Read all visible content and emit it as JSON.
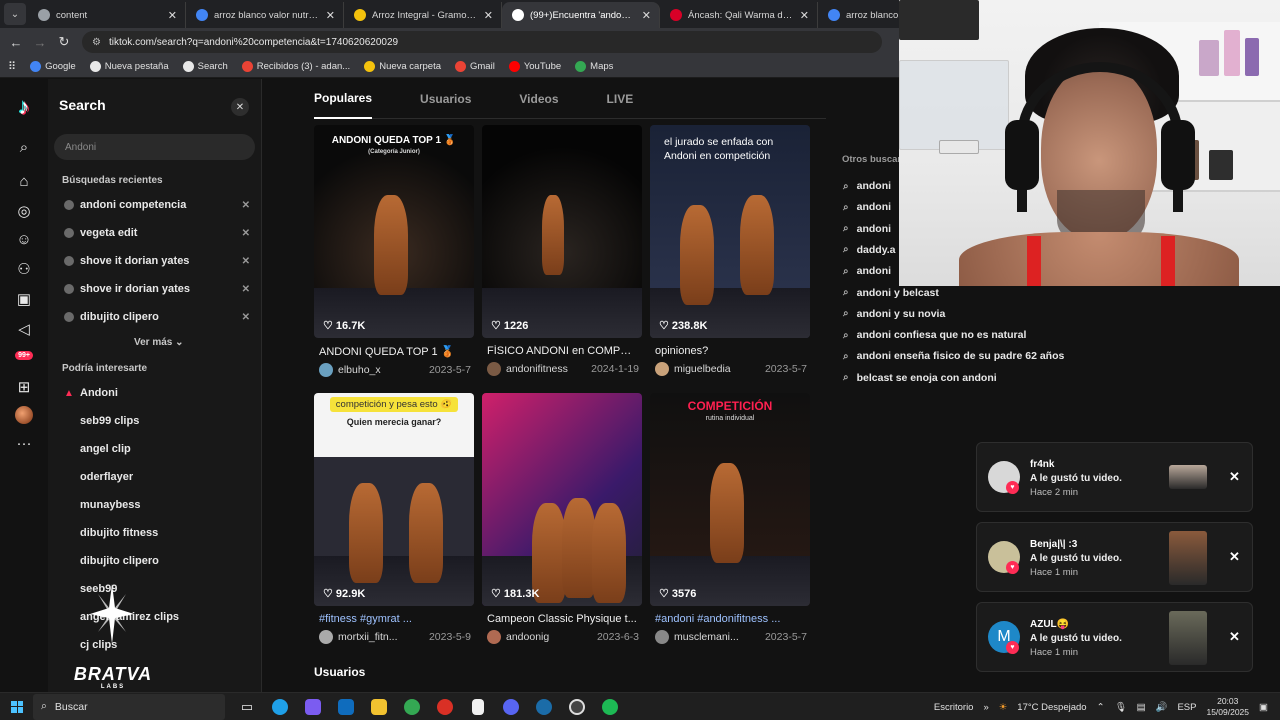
{
  "browser": {
    "tabs": [
      {
        "title": "content",
        "color": "#9aa0a6",
        "active": false
      },
      {
        "title": "arroz blanco valor nutricional - ",
        "color": "#4285f4",
        "active": false
      },
      {
        "title": "Arroz Integral - Gramos (100g)",
        "color": "#f4c20d",
        "active": false
      },
      {
        "title": "(99+)Encuentra 'andoni compe",
        "color": "#ffffff",
        "active": true
      },
      {
        "title": "Áncash: Qali Warma destaca va",
        "color": "#d80027",
        "active": false
      },
      {
        "title": "arroz blanco val",
        "color": "#4285f4",
        "active": false
      }
    ],
    "url": "tiktok.com/search?q=andoni%20competencia&t=1740620620029",
    "bookmarks": [
      {
        "label": "Google",
        "color": "#4285f4"
      },
      {
        "label": "Nueva pestaña",
        "color": "#e8e8e8"
      },
      {
        "label": "Search",
        "color": "#e8e8e8"
      },
      {
        "label": "Recibidos (3) - adan...",
        "color": "#ea4335"
      },
      {
        "label": "Nueva carpeta",
        "color": "#f4c20d"
      },
      {
        "label": "Gmail",
        "color": "#ea4335"
      },
      {
        "label": "YouTube",
        "color": "#ff0000"
      },
      {
        "label": "Maps",
        "color": "#34a853"
      }
    ]
  },
  "rail": {
    "badge": "99+"
  },
  "search_panel": {
    "title": "Search",
    "placeholder": "Andoni",
    "recent_title": "Búsquedas recientes",
    "recent": [
      "andoni competencia",
      "vegeta edit",
      "shove it dorian yates",
      "shove ir dorian yates",
      "dibujito clipero"
    ],
    "see_more": "Ver más",
    "suggest_title": "Podría interesarte",
    "suggestions": [
      "Andoni",
      "seb99 clips",
      "angel clip",
      "oderflayer",
      "munaybess",
      "dibujito fitness",
      "dibujito clipero",
      "seeb99",
      "angel ramirez clips",
      "cj clips"
    ]
  },
  "watermark": {
    "title": "BRATVA",
    "sub": "LABS"
  },
  "content_tabs": [
    "Populares",
    "Usuarios",
    "Videos",
    "LIVE"
  ],
  "videos": [
    {
      "likes": "16.7K",
      "caption": "ANDONI QUEDA TOP 1 🥉",
      "user": "elbuho_x",
      "date": "2023-5-7",
      "overlay": "ANDONI QUEDA TOP 1 🥉",
      "overlay_sub": "(Categoría Junior)",
      "avatar": "#6aa0c0",
      "tag": false
    },
    {
      "likes": "1226",
      "caption": "FÍSICO ANDONI en COMPETI...",
      "user": "andonifitness",
      "date": "2024-1-19",
      "overlay": "",
      "overlay_sub": "",
      "avatar": "#7a5a44",
      "tag": false
    },
    {
      "likes": "238.8K",
      "caption": "opiniones?",
      "user": "miguelbedia",
      "date": "2023-5-7",
      "overlay": "el jurado se enfada con Andoni en competición",
      "overlay_sub": "",
      "avatar": "#c9a27a",
      "tag": false
    },
    {
      "likes": "92.9K",
      "caption": "#fitness #gymrat ...",
      "user": "mortxii_fitn...",
      "date": "2023-5-9",
      "overlay": "competición y pesa esto 🫨",
      "overlay_sub": "Quien merecia ganar?",
      "avatar": "#aaa",
      "tag": true
    },
    {
      "likes": "181.3K",
      "caption": "Campeon Classic Physique t...",
      "user": "andoonig",
      "date": "2023-6-3",
      "overlay": "",
      "overlay_sub": "",
      "avatar": "#b06a52",
      "tag": false
    },
    {
      "likes": "3576",
      "caption": "#andoni #andonifitness ...",
      "user": "musclemani...",
      "date": "2023-5-7",
      "overlay": "COMPETICIÓN",
      "overlay_sub": "rutina individual",
      "avatar": "#888",
      "tag": true
    }
  ],
  "usuarios_heading": "Usuarios",
  "others": {
    "title": "Otros buscar",
    "items": [
      "andoni",
      "andoni",
      "andoni",
      "daddy.a",
      "andoni",
      "andoni y belcast",
      "andoni y su novia",
      "andoni confiesa que no es natural",
      "andoni enseña fisico de su padre 62 años",
      "belcast se enoja con andoni"
    ]
  },
  "notifications": [
    {
      "name": "fr4nk",
      "message": "A le gustó tu video.",
      "time": "Hace 2 min",
      "avatar": "#d8d8d8",
      "thumb": "#b9a89a",
      "initial": ""
    },
    {
      "name": "Benja|\\| :3",
      "message": "A le gustó tu video.",
      "time": "Hace 1 min",
      "avatar": "#c9c09a",
      "thumb": "#8a5a3c",
      "initial": ""
    },
    {
      "name": "AZUL😝",
      "message": "A le gustó tu video.",
      "time": "Hace 1 min",
      "avatar": "#1e88c8",
      "thumb": "#6a6a5a",
      "initial": "M"
    }
  ],
  "taskbar": {
    "search": "Buscar",
    "desktop": "Escritorio",
    "weather": "17°C  Despejado",
    "lang": "ESP",
    "time": "20:03",
    "date": "15/09/2025"
  }
}
